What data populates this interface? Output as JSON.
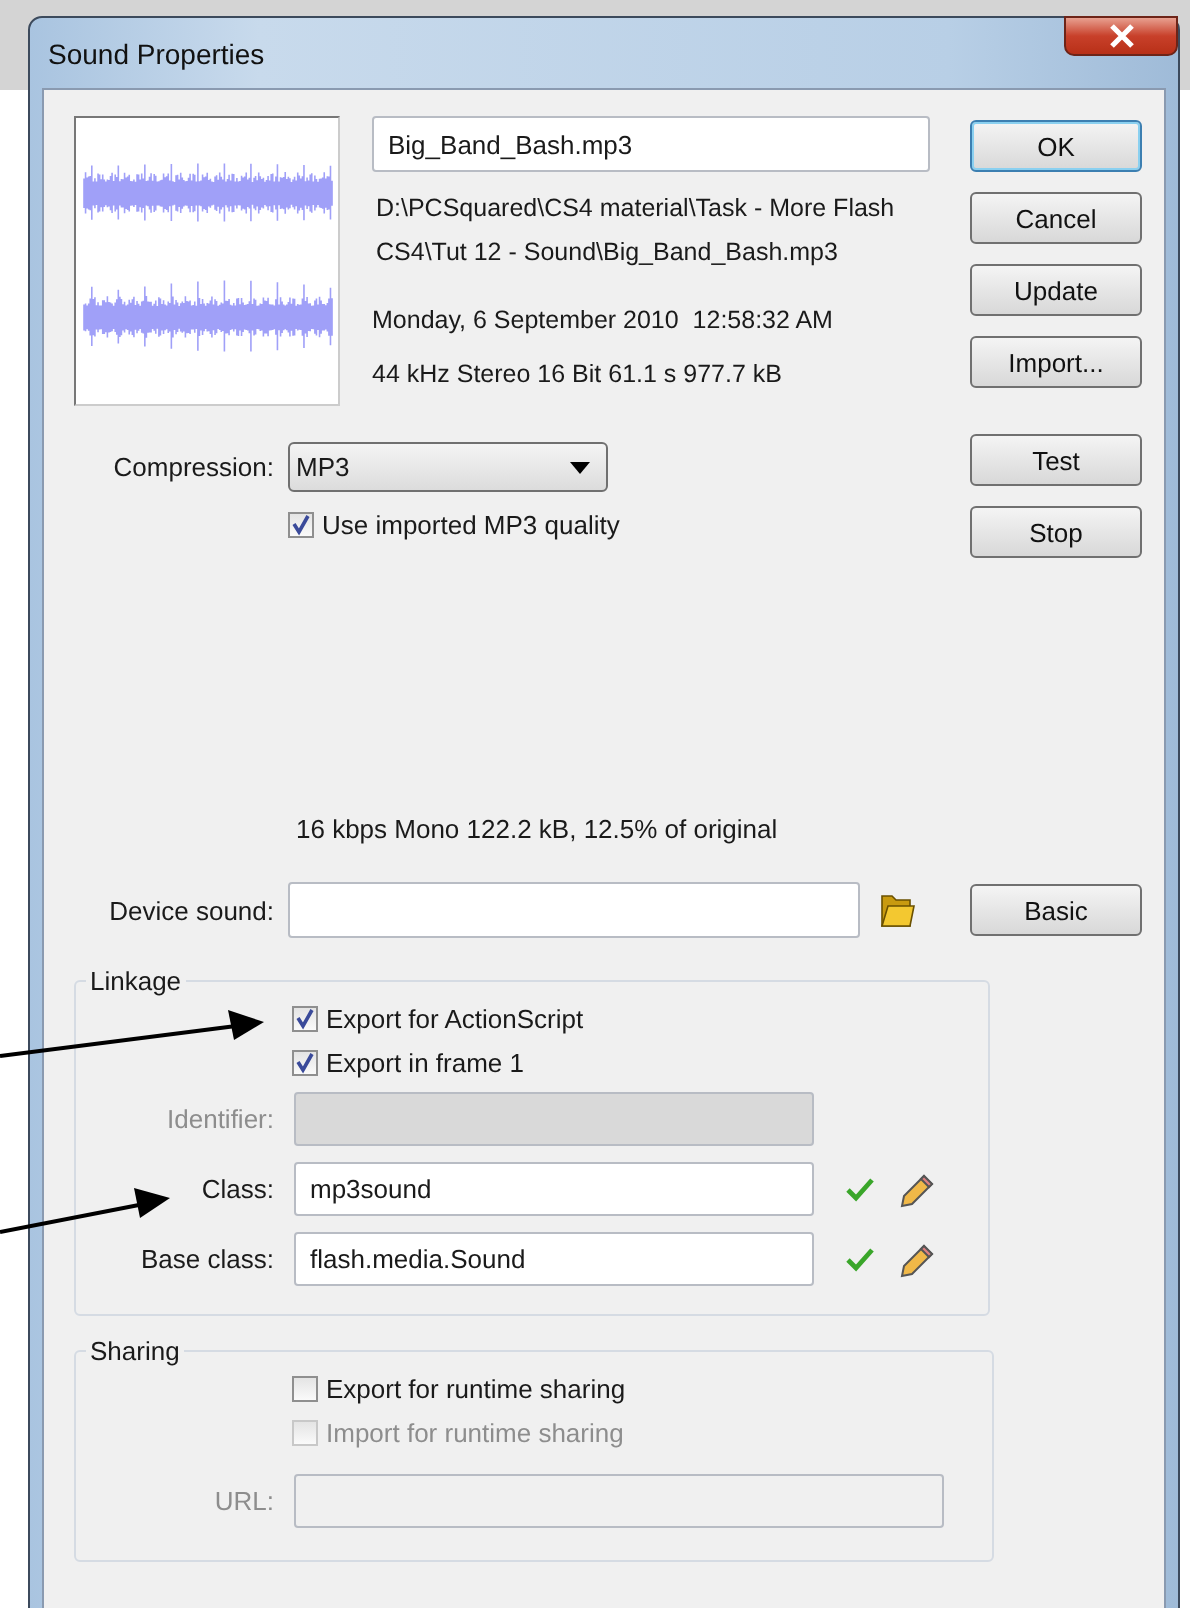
{
  "window": {
    "title": "Sound Properties"
  },
  "sound": {
    "file_name": "Big_Band_Bash.mp3",
    "path_lines": [
      "D:\\PCSquared\\CS4 material\\Task - More Flash",
      "CS4\\Tut 12 - Sound\\Big_Band_Bash.mp3"
    ],
    "date": "Monday, 6 September 2010  12:58:32 AM",
    "format": "44 kHz Stereo 16 Bit 61.1 s 977.7 kB"
  },
  "main_buttons": [
    {
      "label": "OK",
      "default": true
    },
    {
      "label": "Cancel",
      "default": false
    },
    {
      "label": "Update",
      "default": false
    },
    {
      "label": "Import...",
      "default": false
    }
  ],
  "compression": {
    "label": "Compression:",
    "value": "MP3"
  },
  "use_imported_quality": {
    "label": "Use imported MP3 quality",
    "checked": true
  },
  "preview_buttons": [
    {
      "label": "Test",
      "default": false
    },
    {
      "label": "Stop",
      "default": false
    }
  ],
  "compression_info": "16 kbps  Mono 122.2 kB, 12.5% of original",
  "device_sound": {
    "label": "Device sound:"
  },
  "mode_button": {
    "label": "Basic",
    "default": false
  },
  "linkage": {
    "title": "Linkage",
    "checkboxes": [
      {
        "label": "Export for ActionScript",
        "checked": true,
        "disabled": false
      },
      {
        "label": "Export in frame 1",
        "checked": true,
        "disabled": false
      }
    ],
    "fields": [
      {
        "label": "Identifier:",
        "disabled": true,
        "tools": false
      },
      {
        "label": "Class:",
        "value": "mp3sound",
        "disabled": false,
        "tools": true
      },
      {
        "label": "Base class:",
        "value": "flash.media.Sound",
        "disabled": false,
        "tools": true
      }
    ]
  },
  "sharing": {
    "title": "Sharing",
    "checkboxes": [
      {
        "label": "Export for runtime sharing",
        "checked": false,
        "disabled": false
      },
      {
        "label": "Import for runtime sharing",
        "checked": false,
        "disabled": true
      }
    ],
    "fields": [
      {
        "label": "URL:",
        "disabled": true,
        "tools": false
      }
    ]
  }
}
